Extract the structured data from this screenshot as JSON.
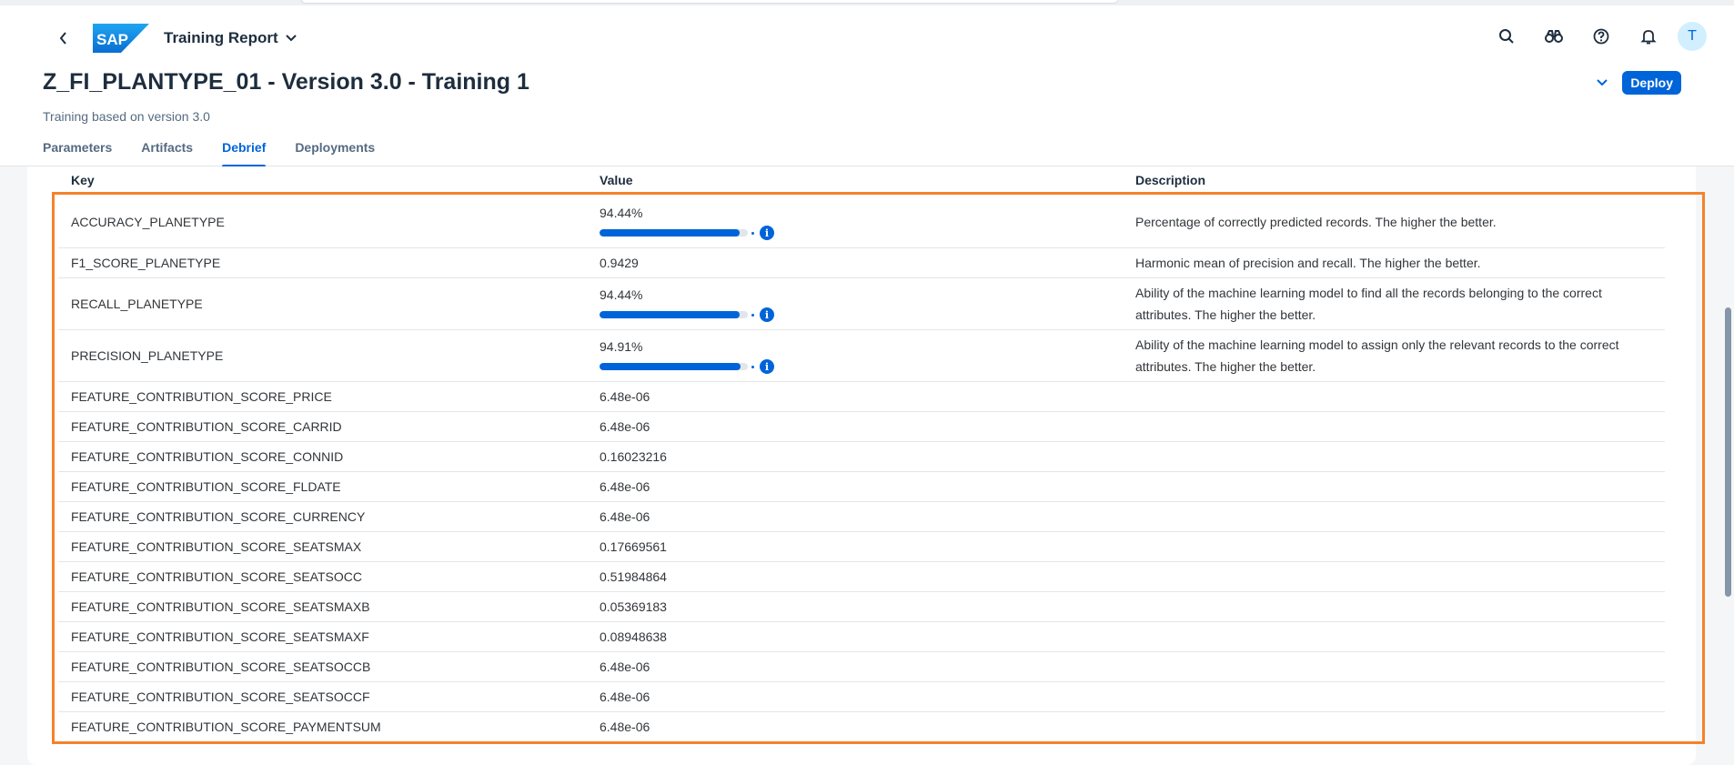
{
  "shell": {
    "logo_text": "SAP",
    "app_title": "Training Report",
    "avatar_initial": "T",
    "icons": [
      "search-icon",
      "binoculars-icon",
      "help-icon",
      "bell-icon"
    ]
  },
  "page": {
    "title": "Z_FI_PLANTYPE_01 - Version 3.0 - Training 1",
    "subtitle": "Training based on version 3.0",
    "deploy_label": "Deploy"
  },
  "tabs": [
    {
      "label": "Parameters",
      "active": false
    },
    {
      "label": "Artifacts",
      "active": false
    },
    {
      "label": "Debrief",
      "active": true
    },
    {
      "label": "Deployments",
      "active": false
    }
  ],
  "table": {
    "headers": {
      "key": "Key",
      "value": "Value",
      "description": "Description"
    },
    "rows": [
      {
        "key": "ACCURACY_PLANETYPE",
        "value": "94.44%",
        "progress": 94.44,
        "description": "Percentage of correctly predicted records. The higher the better."
      },
      {
        "key": "F1_SCORE_PLANETYPE",
        "value": "0.9429",
        "description": "Harmonic mean of precision and recall. The higher the better."
      },
      {
        "key": "RECALL_PLANETYPE",
        "value": "94.44%",
        "progress": 94.44,
        "description": "Ability of the machine learning model to find all the records belonging to the correct attributes. The higher the better."
      },
      {
        "key": "PRECISION_PLANETYPE",
        "value": "94.91%",
        "progress": 94.91,
        "description": "Ability of the machine learning model to assign only the relevant records to the correct attributes. The higher the better."
      },
      {
        "key": "FEATURE_CONTRIBUTION_SCORE_PRICE",
        "value": "6.48e-06",
        "description": ""
      },
      {
        "key": "FEATURE_CONTRIBUTION_SCORE_CARRID",
        "value": "6.48e-06",
        "description": ""
      },
      {
        "key": "FEATURE_CONTRIBUTION_SCORE_CONNID",
        "value": "0.16023216",
        "description": ""
      },
      {
        "key": "FEATURE_CONTRIBUTION_SCORE_FLDATE",
        "value": "6.48e-06",
        "description": ""
      },
      {
        "key": "FEATURE_CONTRIBUTION_SCORE_CURRENCY",
        "value": "6.48e-06",
        "description": ""
      },
      {
        "key": "FEATURE_CONTRIBUTION_SCORE_SEATSMAX",
        "value": "0.17669561",
        "description": ""
      },
      {
        "key": "FEATURE_CONTRIBUTION_SCORE_SEATSOCC",
        "value": "0.51984864",
        "description": ""
      },
      {
        "key": "FEATURE_CONTRIBUTION_SCORE_SEATSMAXB",
        "value": "0.05369183",
        "description": ""
      },
      {
        "key": "FEATURE_CONTRIBUTION_SCORE_SEATSMAXF",
        "value": "0.08948638",
        "description": ""
      },
      {
        "key": "FEATURE_CONTRIBUTION_SCORE_SEATSOCCB",
        "value": "6.48e-06",
        "description": ""
      },
      {
        "key": "FEATURE_CONTRIBUTION_SCORE_SEATSOCCF",
        "value": "6.48e-06",
        "description": ""
      },
      {
        "key": "FEATURE_CONTRIBUTION_SCORE_PAYMENTSUM",
        "value": "6.48e-06",
        "description": ""
      }
    ]
  },
  "colors": {
    "accent": "#0064d9",
    "highlight": "#f5822a"
  }
}
